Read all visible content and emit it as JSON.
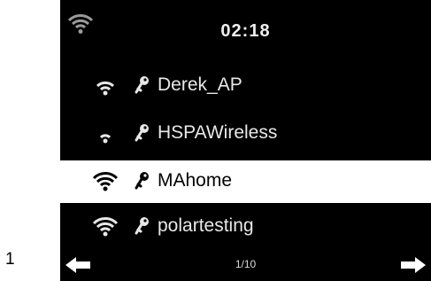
{
  "figure_number": "1",
  "status": {
    "time": "02:18",
    "wifi_icon": "wifi-signal-icon"
  },
  "networks": [
    {
      "name": "Derek_AP",
      "signal": "medium",
      "secured": true,
      "selected": false
    },
    {
      "name": "HSPAWireless",
      "signal": "low",
      "secured": true,
      "selected": false
    },
    {
      "name": "MAhome",
      "signal": "full",
      "secured": true,
      "selected": true
    },
    {
      "name": "polartesting",
      "signal": "full",
      "secured": true,
      "selected": false
    }
  ],
  "footer": {
    "page": "1/10",
    "prev_icon": "arrow-left-icon",
    "next_icon": "arrow-right-icon"
  },
  "colors": {
    "screen_bg": "#000000",
    "text": "#e8e8e8",
    "highlight_bg": "#ffffff",
    "highlight_text": "#000000"
  }
}
